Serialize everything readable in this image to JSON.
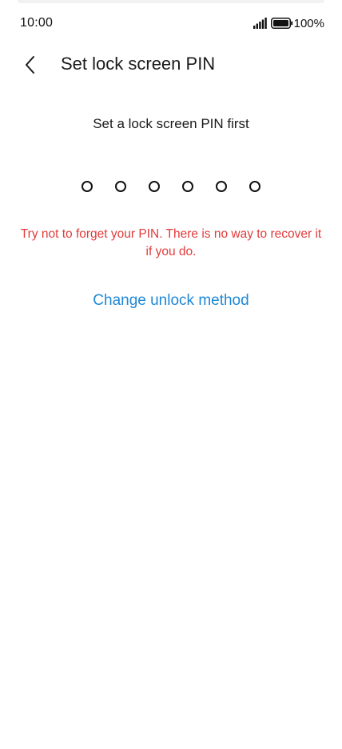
{
  "status_bar": {
    "time": "10:00",
    "battery_percent": "100%",
    "signal_icon": "signal-icon",
    "battery_icon": "battery-icon"
  },
  "header": {
    "back_icon": "chevron-left-icon",
    "title": "Set lock screen PIN"
  },
  "pin_entry": {
    "prompt": "Set a lock screen PIN first",
    "digit_count": 6,
    "entered_count": 0
  },
  "warning": {
    "text": "Try not to forget your PIN. There is no way to recover it if you do."
  },
  "actions": {
    "change_unlock_method": "Change unlock method"
  },
  "colors": {
    "warning": "#e23b3b",
    "link": "#1e88d6",
    "text": "#1a1a1a",
    "background": "#ffffff"
  }
}
